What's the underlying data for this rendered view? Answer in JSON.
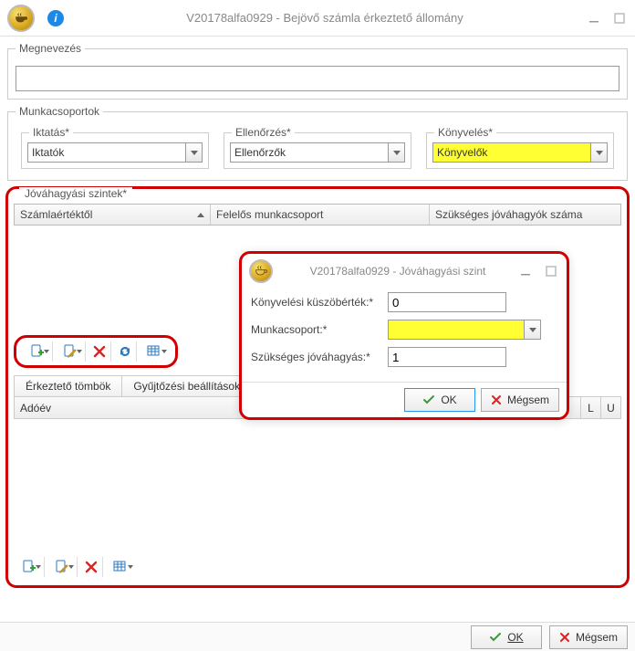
{
  "window": {
    "title": "V20178alfa0929 - Bejövő számla érkeztető állomány"
  },
  "panels": {
    "megnevezes_label": "Megnevezés",
    "megnevezes_value": "",
    "munkacsoportok_label": "Munkacsoportok",
    "iktatas": {
      "label": "Iktatás*",
      "value": "Iktatók"
    },
    "ellenorzes": {
      "label": "Ellenőrzés*",
      "value": "Ellenőrzők"
    },
    "konyveles": {
      "label": "Könyvelés*",
      "value": "Könyvelők"
    }
  },
  "approval": {
    "legend": "Jóváhagyási szintek*",
    "columns": {
      "c1": "Számlaértéktől",
      "c2": "Felelős munkacsoport",
      "c3": "Szükséges jóváhagyók száma"
    }
  },
  "tabs": {
    "t1": "Érkeztető tömbök",
    "t2": "Gyűjtőzési beállítások"
  },
  "adoev": {
    "label": "Adóév",
    "col_l": "L",
    "col_u": "U"
  },
  "dialog": {
    "title": "V20178alfa0929 - Jóváhagyási szint",
    "f1_label": "Könyvelési küszöbérték:*",
    "f1_value": "0",
    "f2_label": "Munkacsoport:*",
    "f2_value": "",
    "f3_label": "Szükséges jóváhagyás:*",
    "f3_value": "1",
    "ok": "OK",
    "cancel": "Mégsem"
  },
  "footer": {
    "ok": "OK",
    "cancel": "Mégsem"
  }
}
